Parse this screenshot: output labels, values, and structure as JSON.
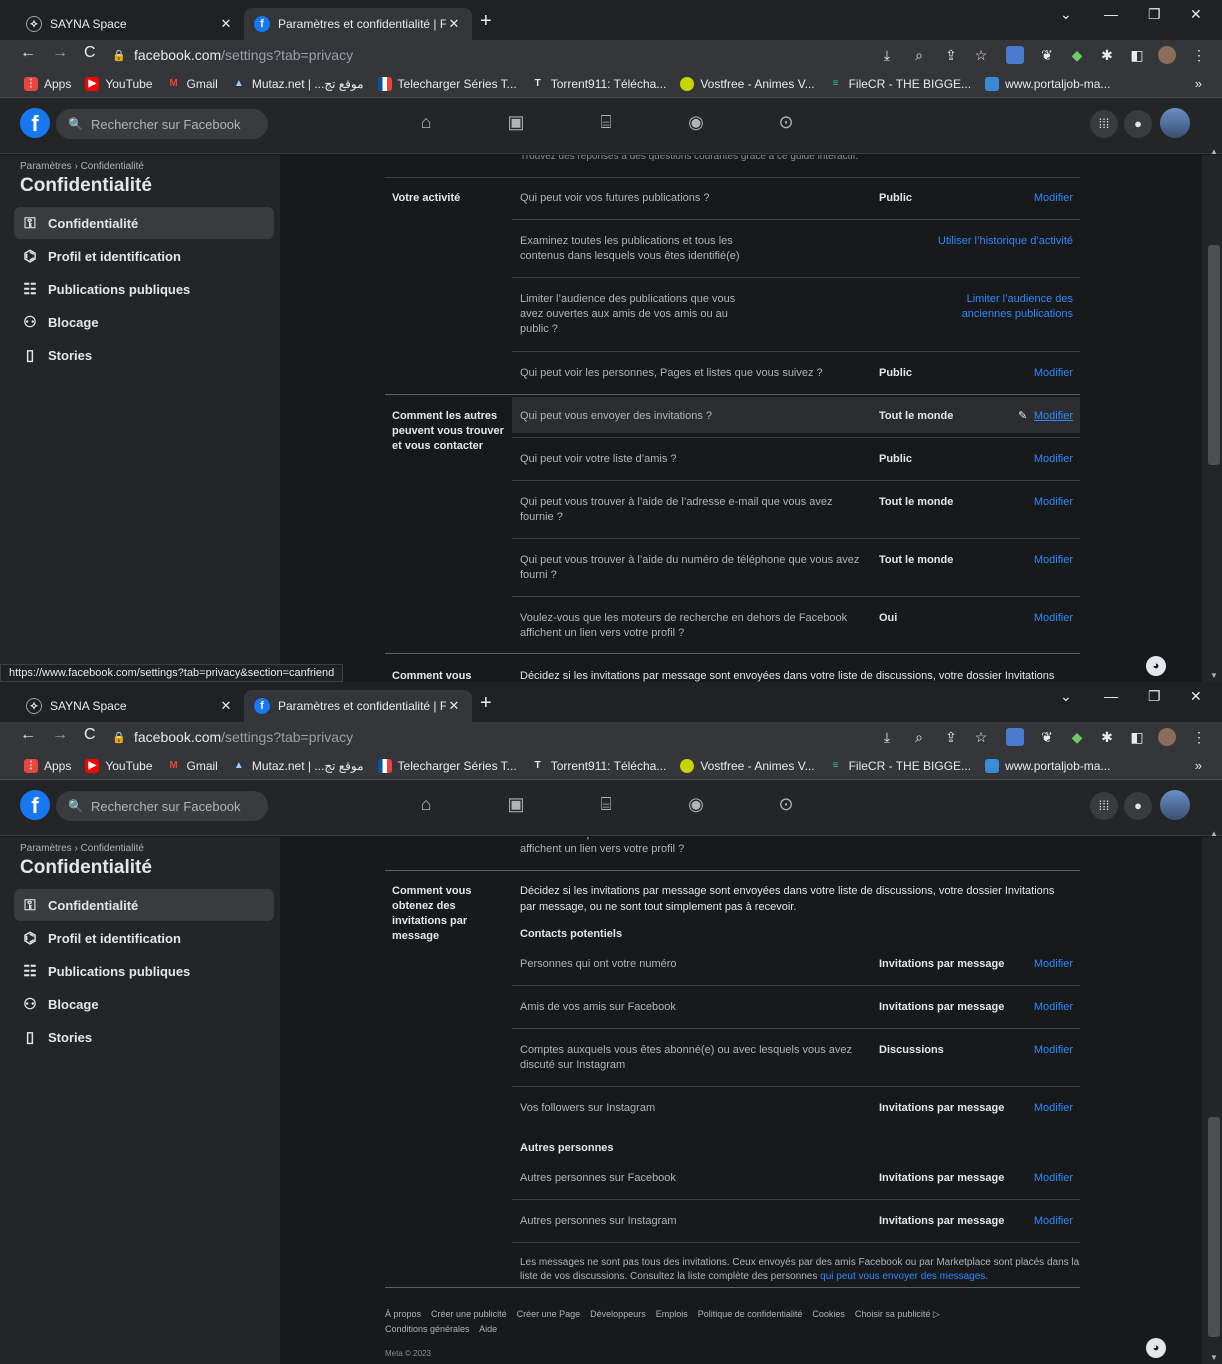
{
  "browser": {
    "tabs": [
      {
        "label": "SAYNA Space",
        "icon": "sayna-icon"
      },
      {
        "label": "Paramètres et confidentialité | Fa",
        "icon": "facebook-icon"
      }
    ],
    "url_host": "facebook.com",
    "url_path": "/settings?tab=privacy",
    "bookmarks": [
      {
        "label": "Apps"
      },
      {
        "label": "YouTube"
      },
      {
        "label": "Gmail"
      },
      {
        "label": "Mutaz.net | ...موقع تج"
      },
      {
        "label": "Telecharger Séries T..."
      },
      {
        "label": "Torrent911: Télécha..."
      },
      {
        "label": "Vostfree - Animes V..."
      },
      {
        "label": "FileCR - THE BIGGE..."
      },
      {
        "label": "www.portaljob-ma..."
      }
    ],
    "bookmarks_more": "»",
    "status_url": "https://www.facebook.com/settings?tab=privacy&section=canfriend"
  },
  "facebook": {
    "search_placeholder": "Rechercher sur Facebook"
  },
  "sidebar": {
    "breadcrumb": "Paramètres › Confidentialité",
    "title": "Confidentialité",
    "items": [
      {
        "label": "Confidentialité",
        "icon": "lock-icon"
      },
      {
        "label": "Profil et identification",
        "icon": "tag-icon"
      },
      {
        "label": "Publications publiques",
        "icon": "public-posts-icon"
      },
      {
        "label": "Blocage",
        "icon": "block-user-icon"
      },
      {
        "label": "Stories",
        "icon": "book-icon"
      }
    ]
  },
  "privacy": {
    "top_hint": "Trouvez des réponses à des questions courantes grâce à ce guide interactif.",
    "activity": {
      "title": "Votre activité",
      "row1_q": "Qui peut voir vos futures publications ?",
      "row1_v": "Public",
      "row2_q1": "Examinez toutes les publications et tous les",
      "row2_q2": "contenus dans lesquels vous êtes identifié(e)",
      "row2_link": "Utiliser l’historique d’activité",
      "row3_q1": "Limiter l’audience des publications que vous",
      "row3_q2": "avez ouvertes aux amis de vos amis ou au",
      "row3_q3": "public ?",
      "row3_link1": "Limiter l’audience des",
      "row3_link2": "anciennes publications",
      "row4_q": "Qui peut voir les personnes, Pages et listes que vous suivez ?",
      "row4_v": "Public"
    },
    "contact": {
      "title1": "Comment les autres",
      "title2": "peuvent vous trouver",
      "title3": "et vous contacter",
      "row1_q": "Qui peut vous envoyer des invitations ?",
      "row1_v": "Tout le monde",
      "row2_q": "Qui peut voir votre liste d’amis ?",
      "row2_v": "Public",
      "row3_q1": "Qui peut vous trouver à l’aide de l’adresse e-mail que vous avez",
      "row3_q2": "fournie ?",
      "row3_v": "Tout le monde",
      "row4_q1": "Qui peut vous trouver à l’aide du numéro de téléphone que vous avez",
      "row4_q2": "fourni ?",
      "row4_v": "Tout le monde",
      "row5_q1": "Voulez-vous que les moteurs de recherche en dehors de Facebook",
      "row5_q2": "affichent un lien vers votre profil ?",
      "row5_v": "Oui"
    },
    "edit_label": "Modifier",
    "messages": {
      "title1": "Comment vous",
      "title2": "obtenez des",
      "title3": "invitations par",
      "title4": "message",
      "desc1": "Décidez si les invitations par message sont envoyées dans votre liste de discussions, votre dossier Invitations",
      "desc2": "par message, ou ne sont tout simplement pas à recevoir.",
      "potential_title": "Contacts potentiels",
      "p1_q": "Personnes qui ont votre numéro",
      "p1_v": "Invitations par message",
      "p2_q": "Amis de vos amis sur Facebook",
      "p2_v": "Invitations par message",
      "p3_q1": "Comptes auxquels vous êtes abonné(e) ou avec lesquels vous avez",
      "p3_q2": "discuté sur Instagram",
      "p3_v": "Discussions",
      "p4_q": "Vos followers sur Instagram",
      "p4_v": "Invitations par message",
      "others_title": "Autres personnes",
      "o1_q": "Autres personnes sur Facebook",
      "o1_v": "Invitations par message",
      "o2_q": "Autres personnes sur Instagram",
      "o2_v": "Invitations par message",
      "note1": "Les messages ne sont pas tous des invitations. Ceux envoyés par des amis Facebook ou par Marketplace sont placés dans la",
      "note2": "liste de vos discussions. Consultez la liste complète des personnes",
      "note_link": "qui peut vous envoyer des messages."
    }
  },
  "footer": {
    "links": [
      "À propos",
      "Créer une publicité",
      "Créer une Page",
      "Développeurs",
      "Emplois",
      "Politique de confidentialité",
      "Cookies",
      "Choisir sa publicité ▷"
    ],
    "links2": [
      "Conditions générales",
      "Aide"
    ],
    "copyright": "Meta © 2023"
  }
}
